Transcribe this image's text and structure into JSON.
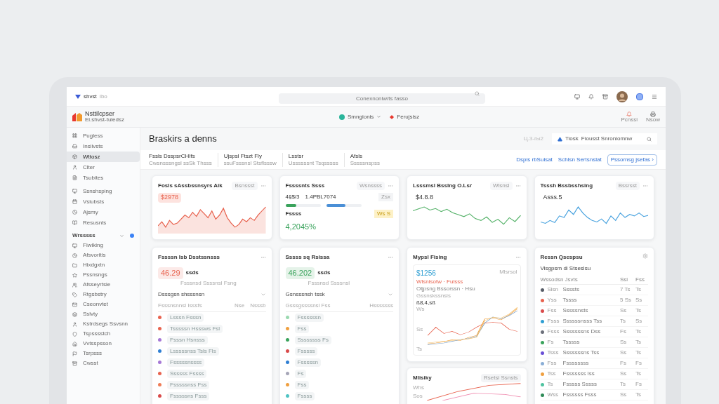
{
  "top_bar": {
    "brand": "shvst",
    "brand_tag": "Ibo",
    "search": {
      "placeholder": "Conexnoniw/ts fasso"
    }
  },
  "header": {
    "title": "Nsttilcpser",
    "subtitle": "Ei.shvst-tuledsz",
    "workspace": "Smngionis",
    "project": "Ferujsisz",
    "actions": [
      "Pcnssi",
      "Nsow"
    ]
  },
  "sidebar": {
    "items": [
      {
        "label": "Pugless",
        "selected": false
      },
      {
        "label": "Insiivsts",
        "selected": false
      },
      {
        "label": "Wttosz",
        "selected": true
      },
      {
        "label": "Clter",
        "selected": false
      },
      {
        "label": "Tsubites",
        "selected": false
      },
      {
        "label": "Ssnshsping",
        "selected": false
      },
      {
        "label": "Vsiubsts",
        "selected": false
      },
      {
        "label": "Ajsmy",
        "selected": false
      },
      {
        "label": "Resusnts",
        "selected": false
      }
    ],
    "section": {
      "title": "Wrsssss",
      "expanded": true,
      "items": [
        "Fiwiking",
        "Afsvoritis",
        "Hixdgxtn",
        "Pssnsngs",
        "Afsseyrtsie",
        "Rtgsbstry",
        "Cseonvtet",
        "Sslvty",
        "Kstrdsegs Ssvsnn",
        "Tspsssstch",
        "Vvtsspsson",
        "Tsrpsss",
        "Cwsst"
      ]
    }
  },
  "page": {
    "title": "Braskirs a denns",
    "date": "Ц.3-гы2",
    "filter": {
      "label": "Tiosk",
      "value": "Fiousst Snroniomnw"
    }
  },
  "summary_tabs": [
    {
      "title": "Fssls DsspsrCHIfs",
      "subtitle": "Cwsnsssngsl ssSk Thsss"
    },
    {
      "title": "Ujspsl Ftszt Fly",
      "subtitle": "ssuFsssnsl Stsflsssw"
    },
    {
      "title": "Lsstsr",
      "subtitle": "Ussssssnt Tsqsssss"
    },
    {
      "title": "Afsls",
      "subtitle": "Sssssnspss"
    }
  ],
  "links": [
    "Dspis rbSuisat",
    "Schlsn Sertsnslat"
  ],
  "primary_button": "Pssornsg jsefas ›",
  "charts": [
    {
      "kind": "area",
      "title": "Fosls sAssbssnsyrs Aik",
      "badge": "Bsnssst",
      "value": "$2978",
      "color": "#e8634f"
    },
    {
      "kind": "stats",
      "title": "Fssssnts Ssss",
      "badge": "Wsnssss",
      "value": "4§$/3",
      "value2": "1.4PBL7074",
      "tag": "Zsx",
      "bars": [
        {
          "level": 0.3,
          "color": "#3aa35c"
        },
        {
          "level": 0.55,
          "color": "#4a8fd6"
        }
      ],
      "label": "Fssss",
      "flag": "Ws S",
      "total": "4,2045%",
      "color": "#3aa35c"
    },
    {
      "kind": "line",
      "title": "Lsssmsl Bsslng O.Lsr",
      "badge": "Wlsnsl",
      "value": "$4.8.8",
      "color": "#57b36b"
    },
    {
      "kind": "line",
      "title": "Tsssh Bssbsshsing",
      "badge": "Bssrsst",
      "value": "Asss.5",
      "color": "#4aa3df"
    }
  ],
  "lists": [
    {
      "title": "Fssssn Isb Dsstssnsss",
      "value": "46.29",
      "unit": "ssds",
      "color": "#e8634f",
      "note": "Fsssnsd Ssssnsl Fsng",
      "subtitle": "Dsssgsn shsssnsn",
      "header": "Fsssnsnnsl Isssfs",
      "cols": [
        "Nse",
        "Nsssb"
      ],
      "rows": [
        {
          "label": "Lsssn Fsssn",
          "color": "#e8634f"
        },
        {
          "label": "Tsssssn Hsssws Fsl",
          "color": "#e8634f"
        },
        {
          "label": "Fsssn Hsnsss",
          "color": "#a678d6"
        },
        {
          "label": "Lsssssnss Tsls Fls",
          "color": "#2f7fd3"
        },
        {
          "label": "Fsssssnssss",
          "color": "#a678d6"
        },
        {
          "label": "Ssssss Fssss",
          "color": "#e8634f"
        },
        {
          "label": "Fsssssnss Fss",
          "color": "#ef7d57"
        },
        {
          "label": "Fsssssns Fsss",
          "color": "#d94a4a"
        }
      ]
    },
    {
      "title": "Sssss sq Rsissa",
      "value": "46.202",
      "unit": "ssds",
      "color": "#3aa35c",
      "note": "Fsssnsd Ssssnsl",
      "subtitle": "Gsnsssnsh tssk",
      "header": "Gsssgssssnsl Fss",
      "cols": [
        "Hsssssss"
      ],
      "rows": [
        {
          "label": "Fssssssn",
          "color": "#9ad9b0"
        },
        {
          "label": "Fss",
          "color": "#f0a040"
        },
        {
          "label": "Ssssssss Fs",
          "color": "#3aa35c"
        },
        {
          "label": "Fsssss",
          "color": "#d94a4a"
        },
        {
          "label": "Fsssssn",
          "color": "#2f7fd3"
        },
        {
          "label": "Fs",
          "color": "#a6a6b8"
        },
        {
          "label": "Fss",
          "color": "#f0a040"
        },
        {
          "label": "Fssss",
          "color": "#4fc3c3"
        }
      ]
    }
  ],
  "trend": {
    "title": "Mypsl Fising",
    "value": "$1256",
    "badge": "Mlsrsol",
    "legend": "Wlsnisotw · Fulsss",
    "note": "Oljpsng Bssorssn · Hsu",
    "label": "Gssnskssnsis",
    "value2": "ß8,4,sß",
    "ticks": [
      "Ws",
      "Ss",
      "Ts"
    ]
  },
  "activity": {
    "title": "Mlisiky",
    "select": "Rsetsi Ssnsts",
    "ticks": [
      "Whs",
      "Sos"
    ]
  },
  "table": {
    "title": "Ressn Qsespsu",
    "subtitle": "Vlsgpsm di Stseslsu",
    "columns": [
      "Wssodsn Jsvts",
      "Ssi",
      "Fss"
    ],
    "rows": [
      {
        "code": "Sisn",
        "name": "Ssssts",
        "a": "7 Ts",
        "b": "Ts",
        "color": "#555b66"
      },
      {
        "code": "Yss",
        "name": "Tssss",
        "a": "5 Ss",
        "b": "Ss",
        "color": "#e8634f"
      },
      {
        "code": "Fss",
        "name": "Sssssnsts",
        "a": "Ss",
        "b": "Ts",
        "color": "#d94a4a"
      },
      {
        "code": "Fsss",
        "name": "Ssssssnsss Tss",
        "a": "Ts",
        "b": "Ss",
        "color": "#2f9fd3"
      },
      {
        "code": "Fsss",
        "name": "Sssssssns Dss",
        "a": "Fs",
        "b": "Ts",
        "color": "#6b6f7a"
      },
      {
        "code": "Fs",
        "name": "Tsssss",
        "a": "Ss",
        "b": "Ts",
        "color": "#3aa35c"
      },
      {
        "code": "Tsss",
        "name": "Sssssssns Tss",
        "a": "Ss",
        "b": "Ts",
        "color": "#6a4fd6"
      },
      {
        "code": "Fss",
        "name": "Fssssssss",
        "a": "Fs",
        "b": "Fs",
        "color": "#8aaed6"
      },
      {
        "code": "Tss",
        "name": "Fsssssss Iss",
        "a": "Ss",
        "b": "Ts",
        "color": "#f0a040"
      },
      {
        "code": "Ts",
        "name": "Fsssss Sssss",
        "a": "Ts",
        "b": "Fs",
        "color": "#4fc3a0"
      },
      {
        "code": "Wss",
        "name": "Fssssss Fsss",
        "a": "Ss",
        "b": "Ts",
        "color": "#2e8b57"
      }
    ]
  }
}
